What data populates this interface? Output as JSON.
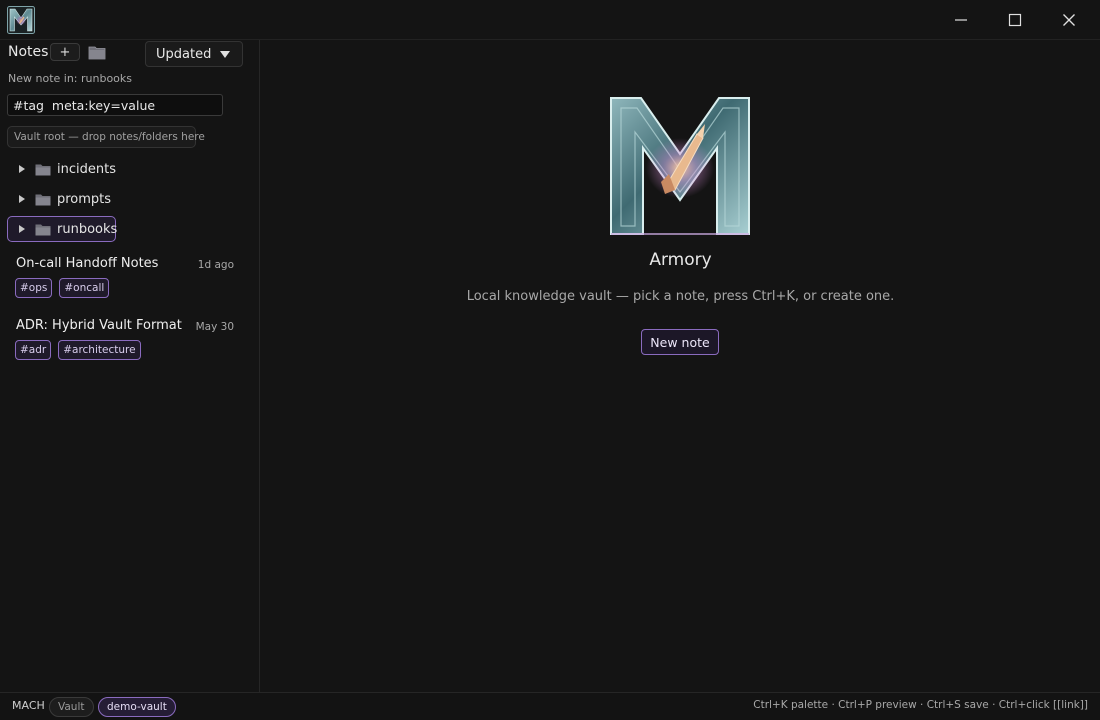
{
  "titlebar": {
    "logo_icon": "armory-m-logo-icon",
    "window_controls": [
      "minimize-icon",
      "maximize-icon",
      "close-icon"
    ]
  },
  "sidebar": {
    "title": "Notes",
    "add_label": "+",
    "sort": {
      "selected": "Updated"
    },
    "new_note_in": "New note in: runbooks",
    "search": {
      "value": "#tag  meta:key=value"
    },
    "drop_zone": "Vault root — drop notes/folders here",
    "folders": [
      {
        "label": "incidents",
        "selected": false
      },
      {
        "label": "prompts",
        "selected": false
      },
      {
        "label": "runbooks",
        "selected": true
      }
    ],
    "notes": [
      {
        "title": "On-call Handoff Notes",
        "date": "1d ago",
        "tags": [
          "#ops",
          "#oncall"
        ]
      },
      {
        "title": "ADR: Hybrid Vault Format",
        "date": "May 30",
        "tags": [
          "#adr",
          "#architecture"
        ]
      }
    ]
  },
  "main": {
    "app_name": "Armory",
    "tagline": "Local knowledge vault — pick a note, press Ctrl+K, or create one.",
    "new_note_button": "New note"
  },
  "statusbar": {
    "brand": "MACH",
    "vault_label": "Vault",
    "vault_name": "demo-vault",
    "shortcuts": "Ctrl+K palette · Ctrl+P preview · Ctrl+S save · Ctrl+click [[link]]"
  },
  "colors": {
    "background": "#141414",
    "accent": "#8a6bbf",
    "accent_bg": "#1f1a2a"
  }
}
